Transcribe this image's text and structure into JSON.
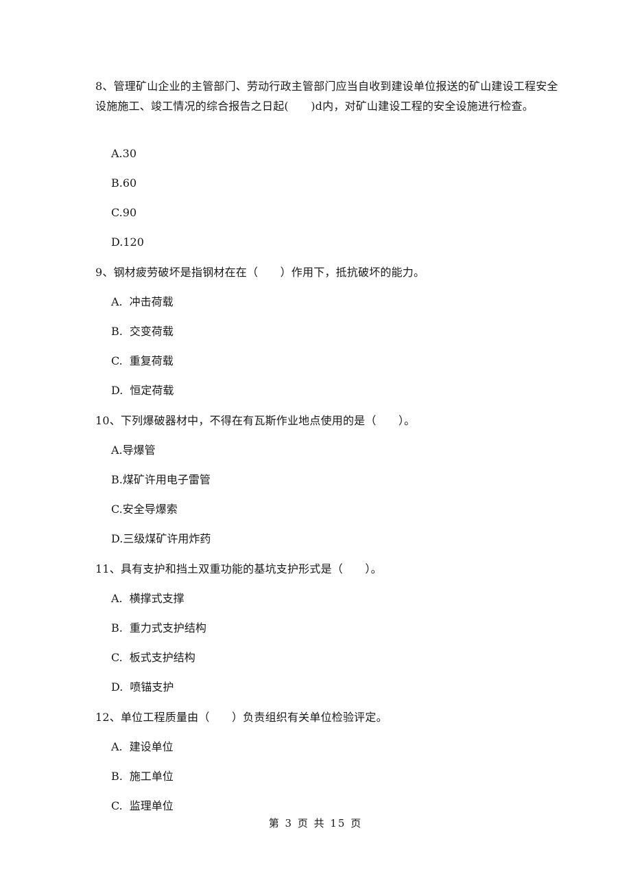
{
  "questions": [
    {
      "number": "8、",
      "text": "管理矿山企业的主管部门、劳动行政主管部门应当自收到建设单位报送的矿山建设工程安全设施施工、竣工情况的综合报告之日起(　　)d内，对矿山建设工程的安全设施进行检查。",
      "options": [
        {
          "label": "A.",
          "text": "30"
        },
        {
          "label": "B.",
          "text": "60"
        },
        {
          "label": "C.",
          "text": "90"
        },
        {
          "label": "D.",
          "text": "120"
        }
      ]
    },
    {
      "number": "9、",
      "text": "钢材疲劳破坏是指钢材在在（　　）作用下，抵抗破坏的能力。",
      "options": [
        {
          "label": "A.",
          "text": "冲击荷载"
        },
        {
          "label": "B.",
          "text": "交变荷载"
        },
        {
          "label": "C.",
          "text": "重复荷载"
        },
        {
          "label": "D.",
          "text": "恒定荷载"
        }
      ]
    },
    {
      "number": "10、",
      "text": "下列爆破器材中，不得在有瓦斯作业地点使用的是（　　）。",
      "options": [
        {
          "label": "A.",
          "text": "导爆管"
        },
        {
          "label": "B.",
          "text": "煤矿许用电子雷管"
        },
        {
          "label": "C.",
          "text": "安全导爆索"
        },
        {
          "label": "D.",
          "text": "三级煤矿许用炸药"
        }
      ]
    },
    {
      "number": "11、",
      "text": "具有支护和挡土双重功能的基坑支护形式是（　　）。",
      "options": [
        {
          "label": "A.",
          "text": "横撑式支撑"
        },
        {
          "label": "B.",
          "text": "重力式支护结构"
        },
        {
          "label": "C.",
          "text": "板式支护结构"
        },
        {
          "label": "D.",
          "text": "喷锚支护"
        }
      ]
    },
    {
      "number": "12、",
      "text": "单位工程质量由（　　）负责组织有关单位检验评定。",
      "options": [
        {
          "label": "A.",
          "text": "建设单位"
        },
        {
          "label": "B.",
          "text": "施工单位"
        },
        {
          "label": "C.",
          "text": "监理单位"
        }
      ]
    }
  ],
  "footer": {
    "text": "第 3 页 共 15 页"
  }
}
